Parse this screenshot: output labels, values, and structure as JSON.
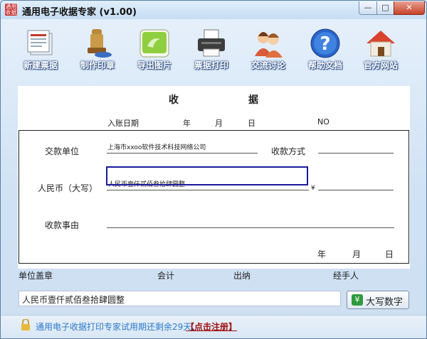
{
  "window": {
    "title": "通用电子收据专家 (v1.00)",
    "icon_text": "通用收据",
    "buttons": {
      "minimize": "—",
      "maximize": "□",
      "close": "✕"
    }
  },
  "toolbar": [
    {
      "label": "新建票据",
      "icon": "new-receipt-icon"
    },
    {
      "label": "制作印章",
      "icon": "seal-icon"
    },
    {
      "label": "导出图片",
      "icon": "export-image-icon"
    },
    {
      "label": "票据打印",
      "icon": "printer-icon"
    },
    {
      "label": "交流讨论",
      "icon": "users-icon"
    },
    {
      "label": "帮助文档",
      "icon": "help-icon"
    },
    {
      "label": "官方网站",
      "icon": "home-icon"
    }
  ],
  "receipt": {
    "title_left": "收",
    "title_right": "据",
    "date_label": "入账日期",
    "year": "年",
    "month": "月",
    "day": "日",
    "no_label": "NO",
    "payer_label": "交款单位",
    "payer_value": "上海市xxoo软件技术科技网络公司",
    "method_label": "收款方式",
    "rmb_label": "人民币（大写）",
    "rmb_value": "人民币壹仟贰佰叁拾肆圆整",
    "yen_sign": "¥",
    "reason_label": "收款事由",
    "sig_year": "年",
    "sig_month": "月",
    "sig_day": "日"
  },
  "footer": {
    "stamp": "单位盖章",
    "accountant": "会计",
    "cashier": "出纳",
    "handler": "经手人"
  },
  "amount_input": {
    "value": "人民币壹仟贰佰叁拾肆圆整"
  },
  "capitalize_button": {
    "label": "大写数字",
    "icon": "yen-icon"
  },
  "status": {
    "text": "通用电子收据打印专家试用期还剩余29天、",
    "register_link": "【点击注册】"
  }
}
